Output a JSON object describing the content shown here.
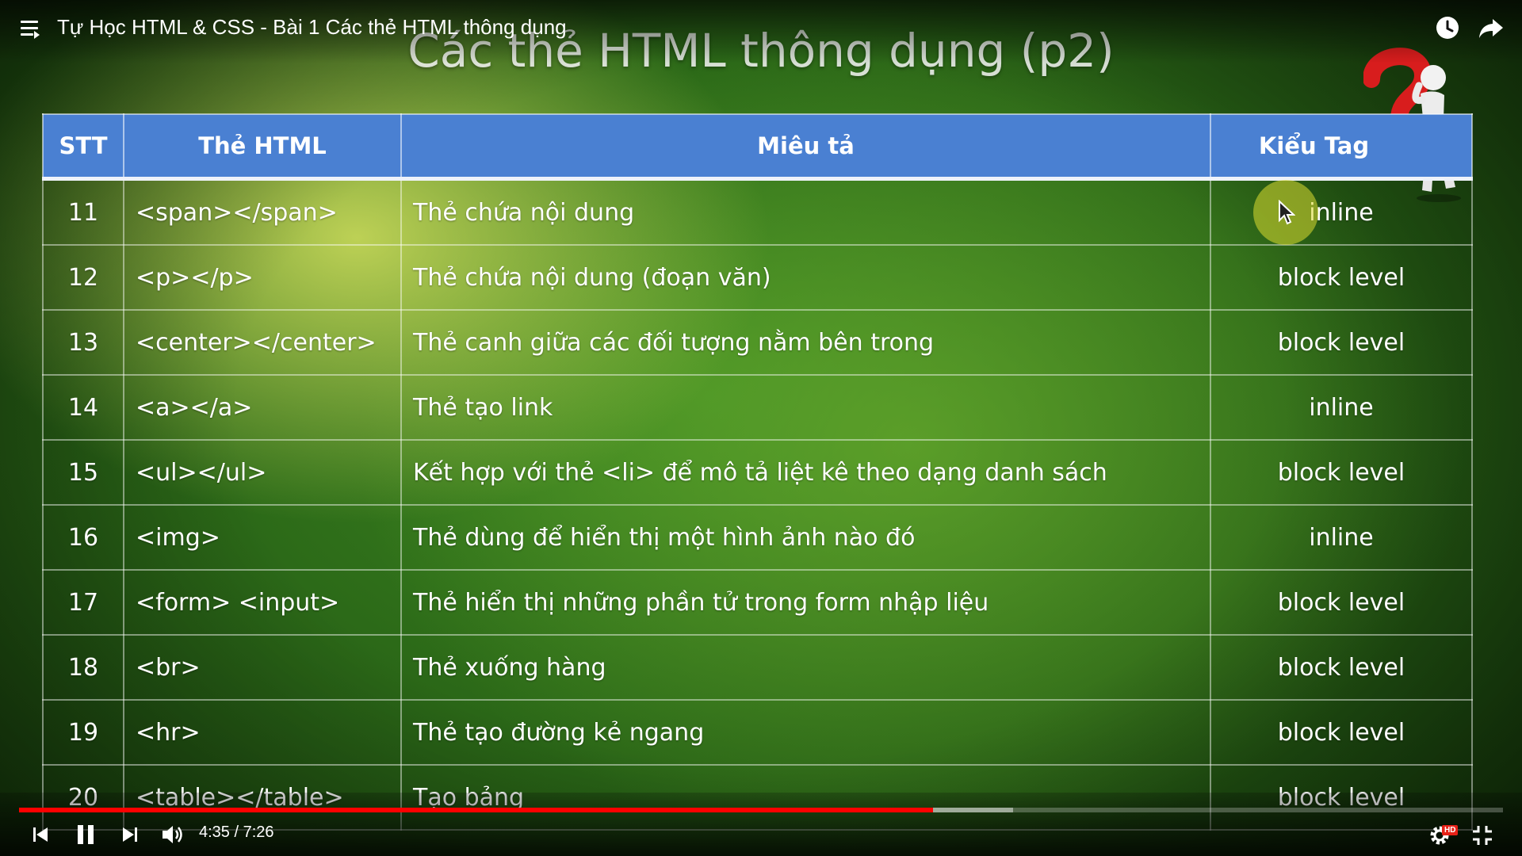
{
  "player": {
    "video_title": "Tự Học HTML & CSS - Bài 1 Các thẻ HTML thông dụng",
    "time_current": "4:35",
    "time_total": "7:26",
    "time_display": "4:35 / 7:26",
    "progress_fraction": 0.616,
    "buffered_fraction": 0.67,
    "hd_badge": "HD",
    "accent_color": "#ff0000"
  },
  "slide": {
    "title": "Các thẻ HTML thông dụng (p2)",
    "header_color": "#4a80d2",
    "columns": [
      "STT",
      "Thẻ HTML",
      "Miêu tả",
      "Kiểu Tag"
    ],
    "rows": [
      {
        "stt": "11",
        "tag": "<span></span>",
        "desc": "Thẻ chứa nội dung",
        "type": "inline"
      },
      {
        "stt": "12",
        "tag": "<p></p>",
        "desc": "Thẻ chứa nội dung (đoạn văn)",
        "type": "block level"
      },
      {
        "stt": "13",
        "tag": "<center></center>",
        "desc": "Thẻ canh giữa các đối tượng nằm bên trong",
        "type": "block level"
      },
      {
        "stt": "14",
        "tag": "<a></a>",
        "desc": "Thẻ tạo link",
        "type": "inline"
      },
      {
        "stt": "15",
        "tag": "<ul></ul>",
        "desc": "Kết hợp với thẻ <li> để mô tả liệt kê theo dạng danh sách",
        "type": "block level"
      },
      {
        "stt": "16",
        "tag": "<img>",
        "desc": "Thẻ dùng để hiển thị một hình ảnh nào đó",
        "type": "inline"
      },
      {
        "stt": "17",
        "tag": "<form> <input>",
        "desc": "Thẻ hiển thị những phần tử trong form nhập liệu",
        "type": "block level"
      },
      {
        "stt": "18",
        "tag": "<br>",
        "desc": "Thẻ xuống hàng",
        "type": "block level"
      },
      {
        "stt": "19",
        "tag": "<hr>",
        "desc": "Thẻ tạo đường kẻ ngang",
        "type": "block level"
      },
      {
        "stt": "20",
        "tag": "<table></table>",
        "desc": "Tạo bảng",
        "type": "block level"
      }
    ]
  },
  "icons": {
    "menu": "playlist-menu-icon",
    "watch_later": "clock-icon",
    "share": "share-arrow-icon",
    "prev": "skip-previous-icon",
    "pause": "pause-icon",
    "next": "skip-next-icon",
    "volume": "volume-icon",
    "settings": "gear-icon",
    "exit_fullscreen": "exit-fullscreen-icon",
    "figure": "question-mark-thinker-figure",
    "cursor": "mouse-pointer-icon"
  }
}
